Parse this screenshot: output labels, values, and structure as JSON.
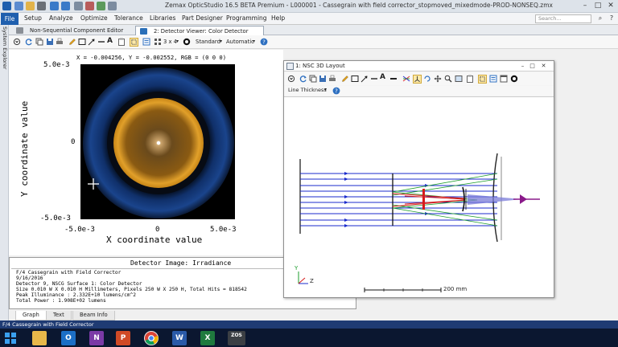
{
  "window": {
    "title": "Zemax OpticStudio 16.5  BETA  Premium - L000001 - Cassegrain with field corrector_stopmoved_mixedmode-PROD-NONSEQ.zmx"
  },
  "menu": {
    "file": "File",
    "items": [
      "Setup",
      "Analyze",
      "Optimize",
      "Tolerance",
      "Libraries",
      "Part Designer",
      "Programming",
      "Help"
    ],
    "search_placeholder": "Search..."
  },
  "side_panel": {
    "label": "System Explorer"
  },
  "tabs": [
    {
      "label": "Non-Sequential Component Editor",
      "active": false
    },
    {
      "label": "2: Detector Viewer: Color Detector",
      "active": true
    }
  ],
  "toolbar": {
    "layout_value": "3 x 4",
    "standard_label": "Standard",
    "automatic_label": "Automatic"
  },
  "detector": {
    "readout": "X = -0.004256, Y = -0.002552, RGB = (0 0 0)",
    "y_axis_label": "Y coordinate value",
    "x_axis_label": "X coordinate value",
    "y_ticks": [
      "5.0e-3",
      "0",
      "-5.0e-3"
    ],
    "x_ticks": [
      "-5.0e-3",
      "0",
      "5.0e-3"
    ],
    "image_title": "Detector Image: Irradiance",
    "info_lines": [
      "F/4 Cassegrain with Field Corrector",
      "9/16/2016",
      "Detector 9, NSCG Surface 1: Color Detector",
      "Size 0.010 W X 0.010 H Millimeters, Pixels 250 W X 250 H, Total Hits = 818542",
      "Peak Illuminance : 2.332E+10 lumens/cm^2",
      "Total Power       : 1.908E+02 lumens"
    ]
  },
  "layout_window": {
    "title": "1: NSC 3D Layout",
    "line_thickness_label": "Line Thickness",
    "scale_label": "200 mm",
    "axis_y": "Y",
    "axis_z": "Z"
  },
  "bottom_tabs": [
    "Graph",
    "Text",
    "Beam Info"
  ],
  "status_bar": {
    "text": "F/4 Cassegrain with Field Corrector"
  },
  "colors": {
    "file_menu": "#1f5fae",
    "status_bar": "#1f3b73",
    "taskbar": "#0b1730",
    "detector_ring": "#e39a1e",
    "detector_halo": "#1e4f9e",
    "ray_blue": "#1b2bcc",
    "ray_green": "#1e9e2e",
    "ray_red": "#d61b1b"
  },
  "taskbar_apps": [
    "windows-icon",
    "file-explorer-icon",
    "outlook-icon",
    "onenote-icon",
    "powerpoint-icon",
    "chrome-icon",
    "word-icon",
    "excel-icon",
    "opticstudio-icon"
  ]
}
